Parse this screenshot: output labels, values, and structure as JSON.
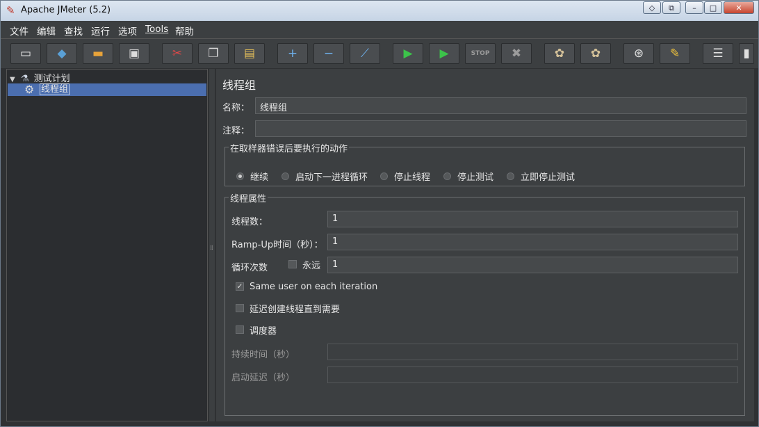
{
  "window": {
    "title": "Apache JMeter (5.2)"
  },
  "titlebar_buttons": {
    "restore_ext": "◇",
    "pin": "⧉",
    "minimize": "–",
    "maximize": "□",
    "close": "✕"
  },
  "menu": [
    "文件",
    "编辑",
    "查找",
    "运行",
    "选项",
    "Tools",
    "帮助"
  ],
  "toolbar": [
    {
      "name": "new",
      "glyph": "▭",
      "color": "#f3f3f3"
    },
    {
      "name": "templates",
      "glyph": "◆",
      "color": "#5aa0d6"
    },
    {
      "name": "open",
      "glyph": "▬",
      "color": "#e8a33a"
    },
    {
      "name": "save",
      "glyph": "▣",
      "color": "#dcdcdc"
    },
    {
      "name": "cut",
      "glyph": "✂",
      "color": "#e04848"
    },
    {
      "name": "copy",
      "glyph": "❐",
      "color": "#dcdcdc"
    },
    {
      "name": "paste",
      "glyph": "▤",
      "color": "#e8c25a"
    },
    {
      "name": "expand",
      "glyph": "+",
      "color": "#6fb3f0"
    },
    {
      "name": "collapse",
      "glyph": "−",
      "color": "#6fb3f0"
    },
    {
      "name": "toggle",
      "glyph": "⟋",
      "color": "#6fb3f0"
    },
    {
      "name": "start",
      "glyph": "▶",
      "color": "#3cc34a"
    },
    {
      "name": "start-no-pauses",
      "glyph": "▶",
      "color": "#3cc34a"
    },
    {
      "name": "stop",
      "glyph": "STOP",
      "color": "#9c9c9c"
    },
    {
      "name": "shutdown",
      "glyph": "✖",
      "color": "#9c9c9c"
    },
    {
      "name": "clear",
      "glyph": "✿",
      "color": "#d6c39a"
    },
    {
      "name": "clear-all",
      "glyph": "✿",
      "color": "#d6c39a"
    },
    {
      "name": "search",
      "glyph": "⊛",
      "color": "#e0e0e0"
    },
    {
      "name": "reset-search",
      "glyph": "✎",
      "color": "#f0c33c"
    },
    {
      "name": "function-helper",
      "glyph": "☰",
      "color": "#e0e0e0"
    },
    {
      "name": "help",
      "glyph": "▮",
      "color": "#e0e0e0"
    }
  ],
  "tree": {
    "root": {
      "label": "测试计划"
    },
    "child": {
      "label": "线程组"
    }
  },
  "panel": {
    "title": "线程组",
    "name_label": "名称：",
    "name_value": "线程组",
    "comment_label": "注释：",
    "comment_value": "",
    "on_error": {
      "legend": "在取样器错误后要执行的动作",
      "options": [
        "继续",
        "启动下一进程循环",
        "停止线程",
        "停止测试",
        "立即停止测试"
      ],
      "selected": "继续"
    },
    "thread_props": {
      "legend": "线程属性",
      "threads_label": "线程数：",
      "threads_value": "1",
      "rampup_label": "Ramp-Up时间（秒）：",
      "rampup_value": "1",
      "loop_label": "循环次数",
      "forever_label": "永远",
      "forever_checked": false,
      "loop_value": "1",
      "same_user_label": "Same user on each iteration",
      "same_user_checked": true,
      "delay_create_label": "延迟创建线程直到需要",
      "delay_create_checked": false,
      "scheduler_label": "调度器",
      "scheduler_checked": false,
      "duration_label": "持续时间（秒）",
      "duration_value": "",
      "startup_delay_label": "启动延迟（秒）",
      "startup_delay_value": ""
    }
  }
}
